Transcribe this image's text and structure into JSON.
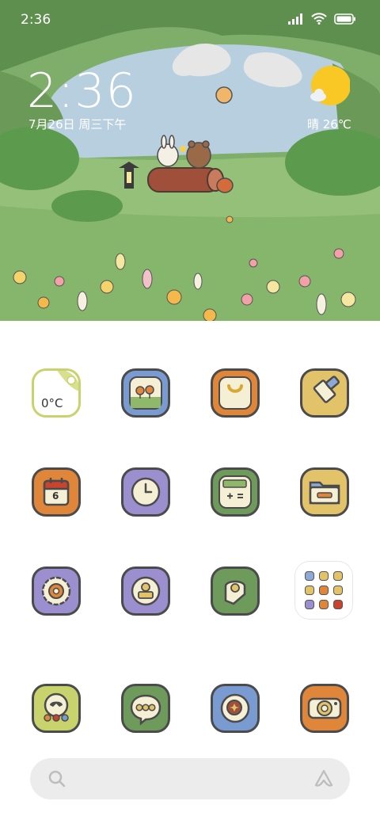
{
  "status_bar": {
    "time": "2:36",
    "icons": [
      "signal-icon",
      "wifi-icon",
      "battery-icon"
    ]
  },
  "lock_widget": {
    "clock": "2:36",
    "date": "7月26日 周三下午",
    "weather": "晴 26℃"
  },
  "apps": {
    "weather": {
      "temperature": "0°C",
      "color": "#d8e08f"
    },
    "gallery": {
      "color": "#7a9ad2"
    },
    "themes": {
      "color": "#e0863a"
    },
    "cleaner": {
      "color": "#e2c36a"
    },
    "calendar": {
      "day": "6",
      "color": "#e0863a"
    },
    "clock": {
      "color": "#9b8fd0"
    },
    "calculator": {
      "color": "#6e9a5c"
    },
    "file_manager": {
      "color": "#e2c36a"
    },
    "settings": {
      "color": "#9b8fd0"
    },
    "security": {
      "color": "#9b8fd0"
    },
    "notes": {
      "color": "#6e9a5c"
    },
    "phone": {
      "color": "#c9d36d"
    },
    "messages": {
      "color": "#6e9a5c"
    },
    "browser": {
      "color": "#7a9ad2"
    },
    "camera": {
      "color": "#e0863a"
    }
  },
  "search_bar": {
    "icon": "search-icon",
    "assistant_icon": "assistant-icon"
  }
}
